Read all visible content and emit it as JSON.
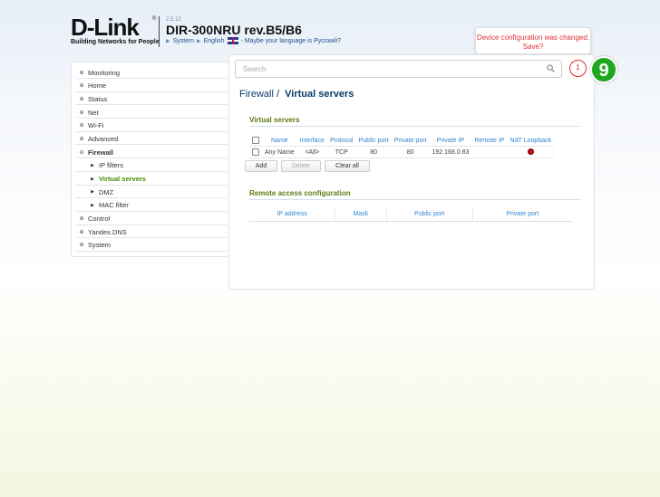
{
  "header": {
    "brand": "D-Link",
    "registered": "®",
    "tagline": "Building Networks for People",
    "firmware": "2.5.12",
    "model": "DIR-300NRU rev.B5/B6",
    "crumbs": {
      "system": "System",
      "language": "English",
      "language_hint": "- Maybe your language is Русский?"
    }
  },
  "notification": {
    "message": "Device configuration was changed. Save?",
    "count": "1"
  },
  "step_badge": "9",
  "search": {
    "placeholder": "Search"
  },
  "sidebar": {
    "items": [
      {
        "label": "Monitoring"
      },
      {
        "label": "Home"
      },
      {
        "label": "Status"
      },
      {
        "label": "Net"
      },
      {
        "label": "Wi-Fi"
      },
      {
        "label": "Advanced"
      },
      {
        "label": "Firewall"
      },
      {
        "label": "IP filters"
      },
      {
        "label": "Virtual servers"
      },
      {
        "label": "DMZ"
      },
      {
        "label": "MAC filter"
      },
      {
        "label": "Control"
      },
      {
        "label": "Yandex.DNS"
      },
      {
        "label": "System"
      }
    ]
  },
  "page": {
    "title_section": "Firewall /",
    "title_page": "Virtual servers"
  },
  "virtual_servers": {
    "heading": "Virtual servers",
    "columns": [
      "Name",
      "Interface",
      "Protocol",
      "Public port",
      "Private port",
      "Private IP",
      "Remote IP",
      "NAT Loopback"
    ],
    "rows": [
      {
        "name": "Any Name",
        "interface": "<All>",
        "protocol": "TCP",
        "public_port": "80",
        "private_port": "80",
        "private_ip": "192.168.0.83",
        "remote_ip": "",
        "nat_loopback": "on"
      }
    ],
    "buttons": {
      "add": "Add",
      "delete": "Delete",
      "clear_all": "Clear all"
    }
  },
  "remote_access": {
    "heading": "Remote access configuration",
    "columns": [
      "IP address",
      "Mask",
      "Public port",
      "Private port"
    ]
  },
  "colors": {
    "accent_green": "#4a8a00",
    "link_blue": "#2e86d1",
    "alert_red": "#e03030",
    "step_green": "#1fa71f"
  }
}
